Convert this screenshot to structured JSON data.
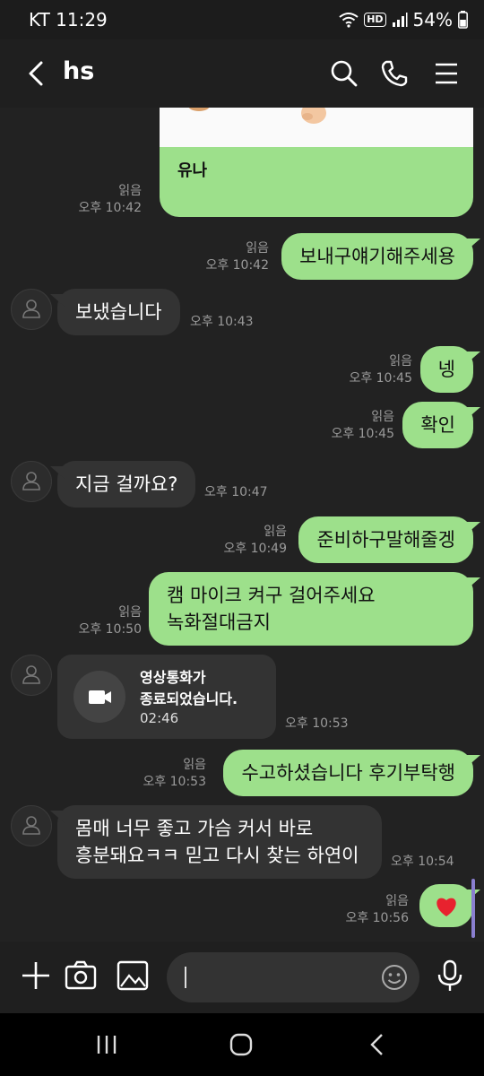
{
  "status": {
    "carrier_time": "KT 11:29",
    "hd": "HD",
    "battery": "54%"
  },
  "header": {
    "title": "hs"
  },
  "card": {
    "label": "유나",
    "read": "읽음",
    "time": "오후 10:42"
  },
  "messages": [
    {
      "text": "보내구얘기해주세용",
      "read": "읽음",
      "time": "오후 10:42"
    },
    {
      "text": "보냈습니다",
      "time": "오후 10:43"
    },
    {
      "text": "넹",
      "read": "읽음",
      "time": "오후 10:45"
    },
    {
      "text": "확인",
      "read": "읽음",
      "time": "오후 10:45"
    },
    {
      "text": "지금 걸까요?",
      "time": "오후 10:47"
    },
    {
      "text": "준비하구말해줄겡",
      "read": "읽음",
      "time": "오후 10:49"
    },
    {
      "line1": "캠 마이크 켜구 걸어주세요",
      "line2": "녹화절대금지",
      "read": "읽음",
      "time": "오후 10:50"
    },
    {
      "line1": "영상통화가",
      "line2": "종료되었습니다.",
      "duration": "02:46",
      "time": "오후 10:53"
    },
    {
      "text": "수고하셨습니다 후기부탁행",
      "read": "읽음",
      "time": "오후 10:53"
    },
    {
      "line1": "몸매 너무 좋고 가슴 커서 바로",
      "line2": "흥분돼요ㅋㅋ 믿고 다시 찾는 하연이",
      "time": "오후 10:54"
    },
    {
      "text": "❤️",
      "read": "읽음",
      "time": "오후 10:56"
    }
  ],
  "icons": [
    "back-icon",
    "search-icon",
    "phone-icon",
    "menu-icon",
    "plus-icon",
    "camera-icon",
    "gallery-icon",
    "emoji-icon",
    "mic-icon",
    "video-icon",
    "person-icon"
  ],
  "colors": {
    "my_bubble": "#9de08b",
    "their_bubble": "#333333",
    "background": "#222222"
  }
}
